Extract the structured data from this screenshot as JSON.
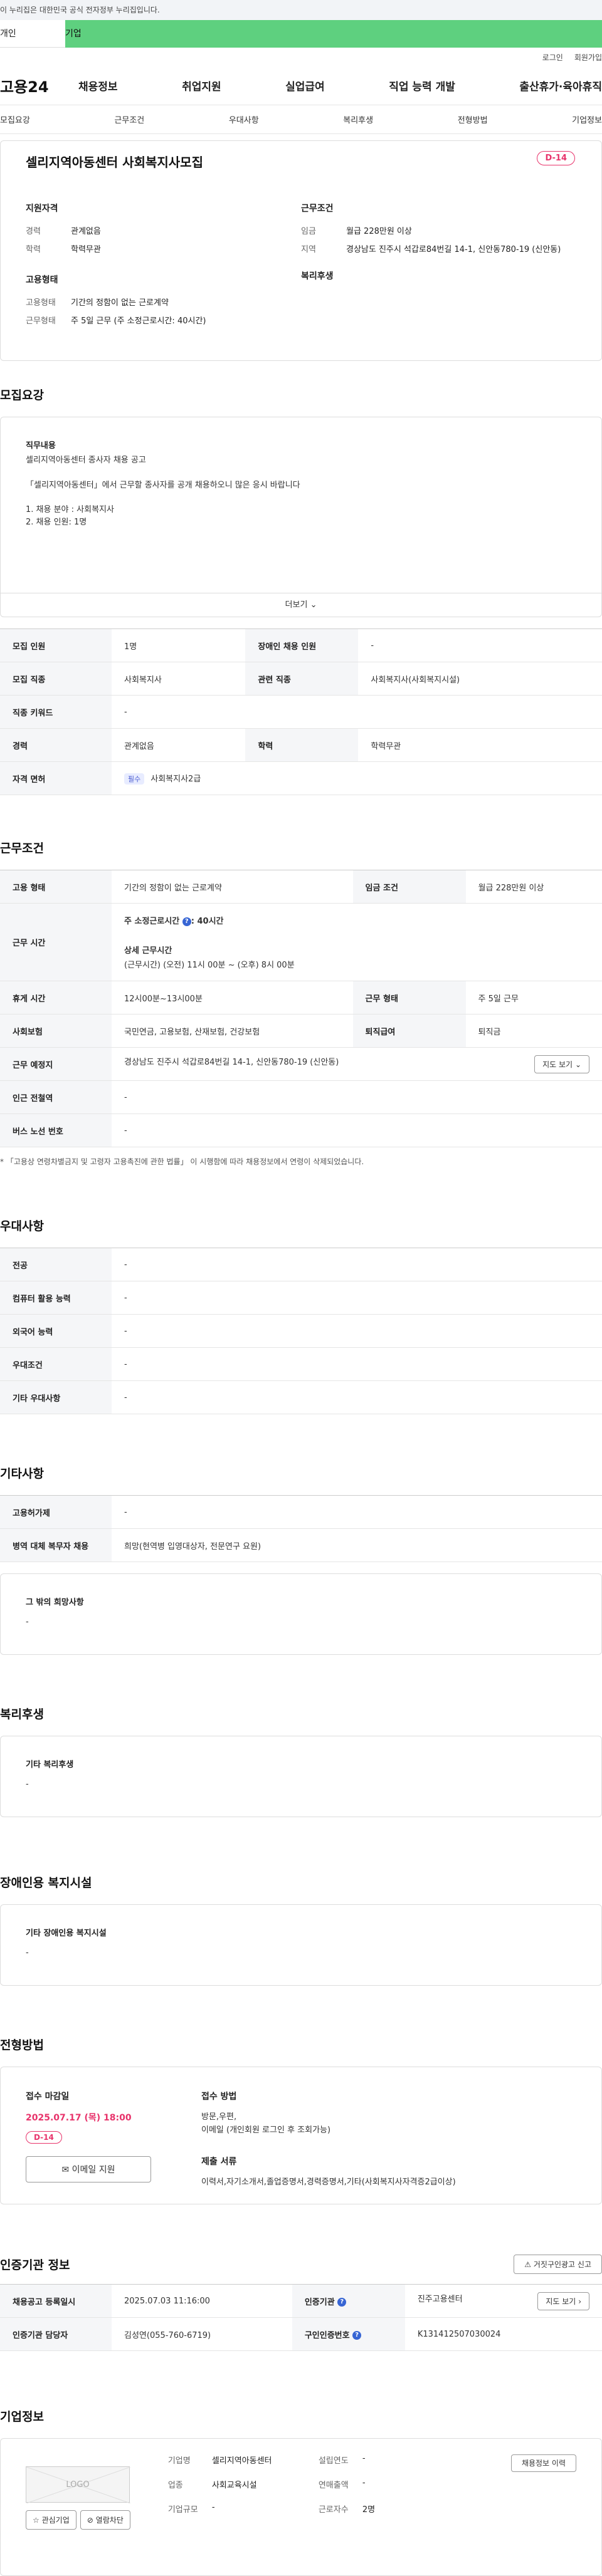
{
  "gov_banner": "이 누리집은 대한민국 공식 전자정부 누리집입니다.",
  "user_tabs": {
    "person": "개인",
    "company": "기업"
  },
  "util": {
    "login": "로그인",
    "signup": "회원가입"
  },
  "logo": "고용24",
  "gnb": [
    "채용정보",
    "취업지원",
    "실업급여",
    "직업 능력 개발",
    "출산휴가·육아휴직"
  ],
  "subnav": [
    "모집요강",
    "근무조건",
    "우대사항",
    "복리후생",
    "전형방법",
    "기업정보"
  ],
  "job": {
    "title": "셀리지역아동센터 사회복지사모집",
    "dday": "D-14",
    "qual_h": "지원자격",
    "career_k": "경력",
    "career_v": "관계없음",
    "edu_k": "학력",
    "edu_v": "학력무관",
    "cond_h": "근무조건",
    "wage_k": "임금",
    "wage_v": "월급 228만원 이상",
    "region_k": "지역",
    "region_v": "경상남도 진주시 석갑로84번길 14-1, 신안동780-19 (신안동)",
    "emp_h": "고용형태",
    "emp_type_k": "고용형태",
    "emp_type_v": "기간의 정함이 없는 근로계약",
    "emp_time_k": "근무형태",
    "emp_time_v": "주 5일 근무 (주 소정근로시간: 40시간)",
    "welfare_h": "복리후생"
  },
  "recruit": {
    "title": "모집요강",
    "duty_h": "직무내용",
    "duty_lines": [
      "셀리지역아동센터 종사자 채용 공고",
      "",
      "「셀리지역아동센터」에서 근무할 종사자를 공개 채용하오니 많은 응시 바랍니다",
      "",
      "1. 채용 분야 :  사회복지사",
      "2. 채용 인원: 1명"
    ],
    "more": "더보기",
    "rows": [
      [
        "모집 인원",
        "1명",
        "장애인 채용 인원",
        "-"
      ],
      [
        "모집 직종",
        "사회복지사",
        "관련 직종",
        "사회복지사(사회복지시설)"
      ],
      [
        "직종 키워드",
        "-"
      ],
      [
        "경력",
        "관계없음",
        "학력",
        "학력무관"
      ]
    ],
    "license_k": "자격 면허",
    "license_pill": "필수",
    "license_v": "사회복지사2급"
  },
  "cond": {
    "title": "근무조건",
    "emp_k": "고용 형태",
    "emp_v": "기간의 정함이 없는 근로계약",
    "wage_k": "임금 조건",
    "wage_v": "월급 228만원 이상",
    "time_k": "근무 시간",
    "time_main_a": "주 소정근로시간",
    "time_main_b": ": 40시간",
    "time_detail_h": "상세 근무시간",
    "time_detail_v": "(근무시간) (오전) 11시 00분 ~ (오후) 8시 00분",
    "rest_k": "휴게 시간",
    "rest_v": "12시00분~13시00분",
    "form_k": "근무 형태",
    "form_v": "주 5일 근무",
    "ins_k": "사회보험",
    "ins_v": "국민연금, 고용보험, 산재보험, 건강보험",
    "sev_k": "퇴직급여",
    "sev_v": "퇴직금",
    "place_k": "근무 예정지",
    "place_v": "경상남도 진주시 석갑로84번길 14-1, 신안동780-19 (신안동)",
    "map_btn": "지도 보기",
    "subway_k": "인근 전철역",
    "subway_v": "-",
    "bus_k": "버스 노선 번호",
    "bus_v": "-",
    "note": "* 「고용상 연령차별금지 및 고령자 고용촉진에 관한 법률」 이 시행함에 따라 채용정보에서 연령이 삭제되었습니다."
  },
  "pref": {
    "title": "우대사항",
    "rows": [
      [
        "전공",
        "-"
      ],
      [
        "컴퓨터 활용 능력",
        "-"
      ],
      [
        "외국어 능력",
        "-"
      ],
      [
        "우대조건",
        "-"
      ],
      [
        "기타 우대사항",
        "-"
      ]
    ]
  },
  "etc": {
    "title": "기타사항",
    "rows": [
      [
        "고용허가제",
        "-"
      ],
      [
        "병역 대체 복무자 채용",
        "희망(현역병 입영대상자, 전문연구 요원)"
      ]
    ],
    "other_h": "그 밖의 희망사항",
    "other_v": "-"
  },
  "welfare": {
    "title": "복리후생",
    "h": "기타 복리후생",
    "v": "-"
  },
  "disabled": {
    "title": "장애인용 복지시설",
    "h": "기타 장애인용 복지시설",
    "v": "-"
  },
  "screening": {
    "title": "전형방법",
    "due_h": "접수 마감일",
    "due_v": "2025.07.17 (목) 18:00",
    "dday": "D-14",
    "email_btn": "이메일 지원",
    "method_h": "접수 방법",
    "method_v1": "방문,우편,",
    "method_v2": "이메일 (개인회원 로그인 후 조회가능)",
    "docs_h": "제출 서류",
    "docs_v": "이력서,자기소개서,졸업증명서,경력증명서,기타(사회복지사자격증2급이상)"
  },
  "cert": {
    "title": "인증기관 정보",
    "false_report_btn": "거짓구인광고 신고",
    "reg_k": "채용공고 등록일시",
    "reg_v": "2025.07.03 11:16:00",
    "org_k": "인증기관",
    "org_v": "진주고용센터",
    "map_btn": "지도 보기",
    "mgr_k": "인증기관 담당자",
    "mgr_v": "김성연(055-760-6719)",
    "no_k": "구인인증번호",
    "no_v": "K131412507030024"
  },
  "company": {
    "title": "기업정보",
    "logo_placeholder": "LOGO",
    "fav_btn": "관심기업",
    "block_btn": "열람차단",
    "name_k": "기업명",
    "name_v": "셀리지역아동센터",
    "founded_k": "설립연도",
    "founded_v": "-",
    "biz_k": "업종",
    "biz_v": "사회교육시설",
    "sales_k": "연매출액",
    "sales_v": "-",
    "size_k": "기업규모",
    "size_v": "-",
    "emp_k": "근로자수",
    "emp_v": "2명",
    "history_btn": "채용정보 이력"
  }
}
